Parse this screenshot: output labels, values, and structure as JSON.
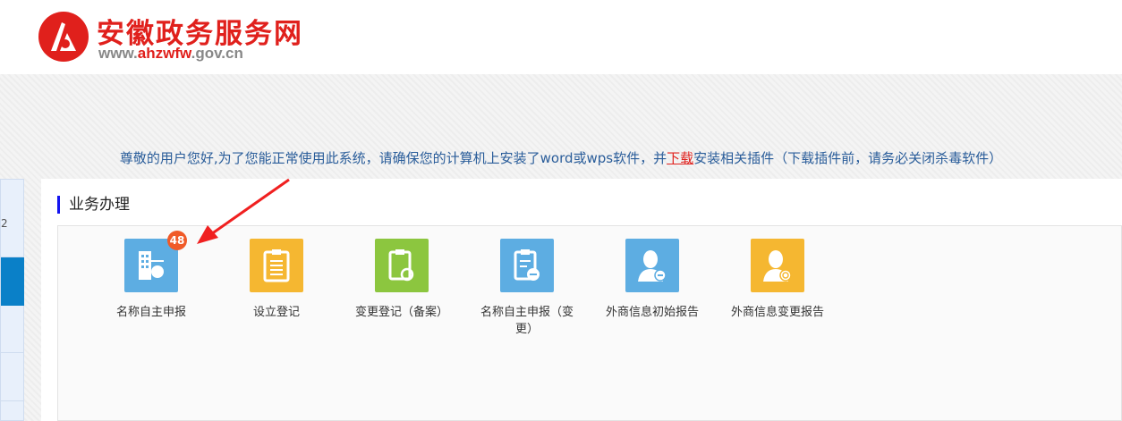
{
  "header": {
    "title": "安徽政务服务网",
    "url_prefix": "www.",
    "url_highlight": "ahzwfw",
    "url_suffix": ".gov.cn"
  },
  "notice": {
    "before": "尊敬的用户您好,为了您能正常使用此系统，请确保您的计算机上安装了word或wps软件，并",
    "link": "下载",
    "after": "安装相关插件（下载插件前，请务必关闭杀毒软件）"
  },
  "sidebar": {
    "items": [
      {
        "label": "2"
      }
    ]
  },
  "section": {
    "title": "业务办理"
  },
  "tiles": [
    {
      "label": "名称自主申报",
      "badge": "48",
      "color": "#5dade2",
      "icon": "building-icon"
    },
    {
      "label": "设立登记",
      "color": "#f5b731",
      "icon": "clipboard-icon"
    },
    {
      "label": "变更登记（备案）",
      "color": "#8cc63f",
      "icon": "clipboard-refresh-icon"
    },
    {
      "label": "名称自主申报（变更）",
      "color": "#5dade2",
      "icon": "clipboard-edit-icon"
    },
    {
      "label": "外商信息初始报告",
      "color": "#5dade2",
      "icon": "person-icon"
    },
    {
      "label": "外商信息变更报告",
      "color": "#f5b731",
      "icon": "person-refresh-icon"
    }
  ]
}
